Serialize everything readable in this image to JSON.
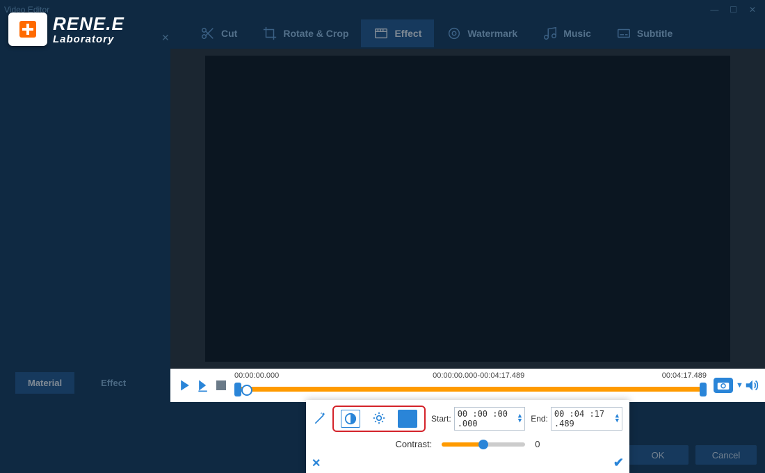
{
  "window": {
    "title": "Video Editor"
  },
  "brand": {
    "name": "RENE.E",
    "sub": "Laboratory"
  },
  "toolbar": {
    "cut": "Cut",
    "rotate": "Rotate & Crop",
    "effect": "Effect",
    "watermark": "Watermark",
    "music": "Music",
    "subtitle": "Subtitle"
  },
  "side_tabs": {
    "material": "Material",
    "effect": "Effect"
  },
  "timeline": {
    "start_tick": "00:00:00.000",
    "range": "00:00:00.000-00:04:17.489",
    "end_tick": "00:04:17.489"
  },
  "effect_panel": {
    "start_label": "Start:",
    "start_value": "00 :00 :00 .000",
    "end_label": "End:",
    "end_value": "00 :04 :17 .489",
    "contrast_label": "Contrast:",
    "contrast_value": "0"
  },
  "footer": {
    "ok": "OK",
    "cancel": "Cancel"
  }
}
